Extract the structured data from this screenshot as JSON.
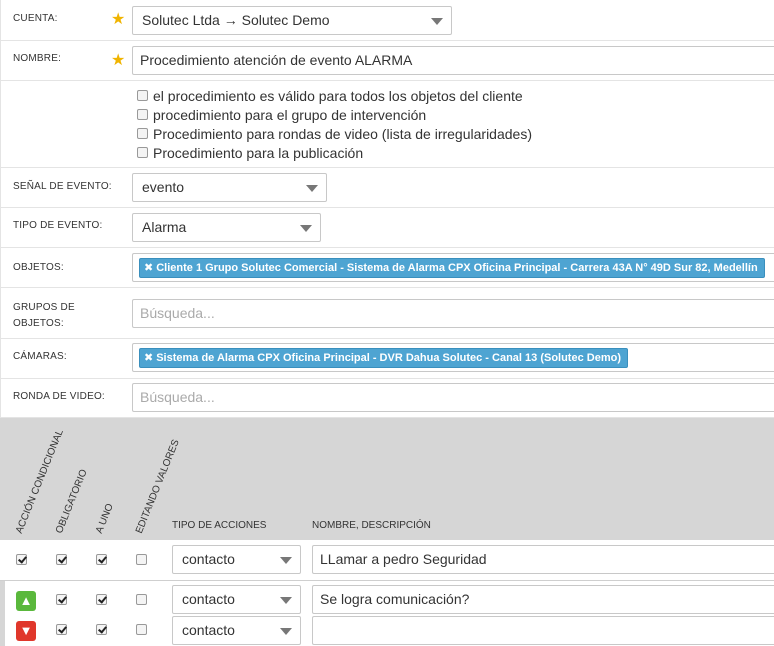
{
  "cuenta": {
    "label": "CUENTA:",
    "value": "Solutec Ltda → Solutec Demo"
  },
  "nombre": {
    "label": "NOMBRE:",
    "value": "Procedimiento atención de evento ALARMA"
  },
  "options": [
    {
      "label": "el procedimiento es válido para todos los objetos del cliente",
      "checked": false
    },
    {
      "label": "procedimiento para el grupo de intervención",
      "checked": false
    },
    {
      "label": "Procedimiento para rondas de video (lista de irregularidades)",
      "checked": false
    },
    {
      "label": "Procedimiento para la publicación",
      "checked": false
    }
  ],
  "senal": {
    "label": "SEÑAL DE EVENTO:",
    "value": "evento"
  },
  "tipo": {
    "label": "TIPO DE EVENTO:",
    "value": "Alarma"
  },
  "objetos": {
    "label": "OBJETOS:",
    "tag": "Cliente 1 Grupo Solutec Comercial - Sistema de Alarma CPX Oficina Principal - Carrera 43A N° 49D Sur 82, Medellín"
  },
  "grupos": {
    "label": "GRUPOS DE OBJETOS:",
    "label1": "GRUPOS DE",
    "label2": "OBJETOS:",
    "placeholder": "Búsqueda..."
  },
  "camaras": {
    "label": "CÁMARAS:",
    "tag": "Sistema de Alarma CPX Oficina Principal - DVR Dahua Solutec - Canal 13 (Solutec Demo)"
  },
  "ronda": {
    "label": "RONDA DE VIDEO:",
    "placeholder": "Búsqueda..."
  },
  "table": {
    "headers": {
      "accion_condicional": "ACCIÓN CONDICIONAL",
      "obligatorio": "OBLIGATORIO",
      "a_uno": "A UNO",
      "editando_valores": "EDITANDO VALORES",
      "tipo_acciones": "TIPO DE ACCIONES",
      "nombre_descripcion": "NOMBRE, DESCRIPCIÓN"
    },
    "rows": [
      {
        "marker": "checkbox",
        "accion": true,
        "obligatorio": true,
        "a_uno": true,
        "editando": false,
        "tipo": "contacto",
        "nombre": "LLamar a pedro Seguridad"
      },
      {
        "marker": "thumb-up",
        "obligatorio": true,
        "a_uno": true,
        "editando": false,
        "tipo": "contacto",
        "nombre": "Se logra comunicación?"
      },
      {
        "marker": "thumb-down",
        "obligatorio": true,
        "a_uno": true,
        "editando": false,
        "tipo": "contacto",
        "nombre": ""
      }
    ]
  },
  "colors": {
    "tag": "#4ea4d2",
    "required": "#f0b400",
    "thumb_up": "#5ab83c",
    "thumb_down": "#e0372b",
    "header_bg": "#d6d6d6"
  }
}
